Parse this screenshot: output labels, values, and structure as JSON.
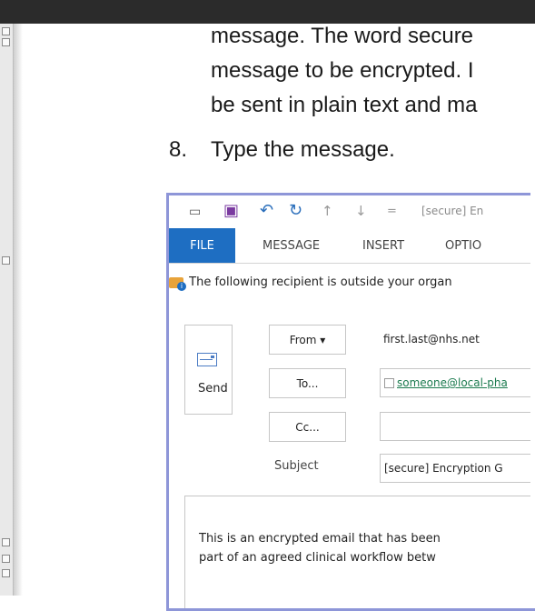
{
  "doc": {
    "lines": [
      "message. The word secure",
      "message to be encrypted. I",
      "be sent in plain text and ma"
    ],
    "step_number": "8.",
    "step_text": "Type the message."
  },
  "outlook": {
    "title": "[secure] En",
    "tabs": [
      "FILE",
      "MESSAGE",
      "INSERT",
      "OPTIO"
    ],
    "info_bar": "The following recipient is outside your organ",
    "send_label": "Send",
    "from_label": "From ▾",
    "from_value": "first.last@nhs.net",
    "to_label": "To...",
    "to_value": "someone@local-pha",
    "cc_label": "Cc...",
    "subject_label": "Subject",
    "subject_value": "[secure] Encryption G",
    "body_lines": [
      "This is an encrypted email that has been",
      "part of an agreed clinical workflow betw"
    ]
  },
  "colors": {
    "accent": "#1e6ec2",
    "border_highlight": "#8e96d8"
  }
}
